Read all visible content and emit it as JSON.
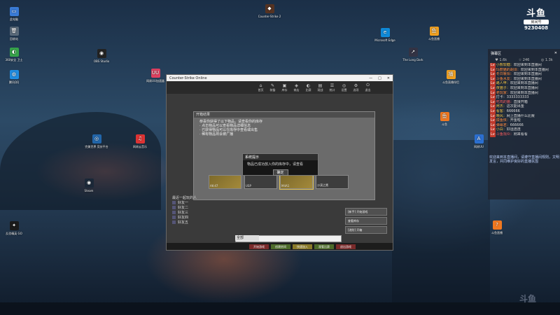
{
  "desktop": {
    "icons_left": [
      {
        "label": "此电脑",
        "color": "#3a7bd5",
        "glyph": "▭"
      },
      {
        "label": "回收站",
        "color": "#5a6a7a",
        "glyph": "🗑"
      },
      {
        "label": "360安全\n卫士",
        "color": "#36a34a",
        "glyph": "◐"
      },
      {
        "label": "腾讯QQ",
        "color": "#1f8ce0",
        "glyph": "◍"
      },
      {
        "label": "完美世界\n竞技平台",
        "color": "#2266aa",
        "glyph": "◎"
      },
      {
        "label": "Steam",
        "color": "#1b2838",
        "glyph": "◉"
      },
      {
        "label": "反恐精英\nGO",
        "color": "#1a1a1a",
        "glyph": "✦"
      }
    ],
    "icons_mid": [
      {
        "label": "OBS Studio",
        "color": "#222",
        "glyph": "◉"
      },
      {
        "label": "网易UU加速器",
        "color": "#e04060",
        "glyph": "UU"
      },
      {
        "label": "网易云音乐",
        "color": "#d33",
        "glyph": "♫"
      },
      {
        "label": "Counter-Strike 2",
        "color": "#553322",
        "glyph": "◆"
      }
    ],
    "icons_right": [
      {
        "label": "Microsoft Edge",
        "color": "#0f8ad8",
        "glyph": "e"
      },
      {
        "label": "斗鱼直播",
        "color": "#f0a020",
        "glyph": "鱼"
      },
      {
        "label": "The Long Dark",
        "color": "#334",
        "glyph": "↗"
      },
      {
        "label": "斗鱼直播伴侣",
        "color": "#f0a020",
        "glyph": "播"
      },
      {
        "label": "斗鱼",
        "color": "#f07820",
        "glyph": "鱼"
      },
      {
        "label": "网易UU",
        "color": "#2b6fd0",
        "glyph": "A"
      },
      {
        "label": "斗鱼直播",
        "color": "#f07820",
        "glyph": "?"
      }
    ]
  },
  "logo": {
    "brand": "斗鱼",
    "room_label": "房间号",
    "room_number": "9230408"
  },
  "chat": {
    "title": "弹幕区",
    "stats": [
      "♥ 1.6k",
      "☆ 246",
      "◎ 1.3k"
    ],
    "messages": [
      {
        "user": "小熊软糖",
        "text": "欢迎来到本直播间",
        "cls": "u-y"
      },
      {
        "user": "玛丽猫的胡须",
        "text": "欢迎来到本直播间",
        "cls": "u-o"
      },
      {
        "user": "冬日暖阳",
        "text": "欢迎来到本直播间",
        "cls": "u-o"
      },
      {
        "user": "斗鱼水友",
        "text": "欢迎来到本直播间",
        "cls": "u-o"
      },
      {
        "user": "路人甲",
        "text": "欢迎来到本直播间",
        "cls": "u-y"
      },
      {
        "user": "夜猫子",
        "text": "欢迎来到本直播间",
        "cls": "u-y"
      },
      {
        "user": "老玩家",
        "text": "欢迎来到本直播间",
        "cls": "u-o"
      },
      {
        "user": "打卡",
        "text": "3333333333",
        "cls": "u-w"
      },
      {
        "user": "吃鸡的猫",
        "text": "直接开箱",
        "cls": "u-r"
      },
      {
        "user": "阿杰",
        "text": "这次能出金",
        "cls": "u-y"
      },
      {
        "user": "看客",
        "text": "666666",
        "cls": "u-y"
      },
      {
        "user": "晚风",
        "text": "网上直播什么比赛",
        "cls": "u-y"
      },
      {
        "user": "摸鱼侠",
        "text": "开金啦",
        "cls": "u-o"
      },
      {
        "user": "弹幕君",
        "text": "666666",
        "cls": "u-o"
      },
      {
        "user": "小白",
        "text": "好运连连",
        "cls": "u-y"
      },
      {
        "user": "斗鱼观众",
        "text": "刚来看看",
        "cls": "u-r"
      }
    ],
    "notice": "欢迎来到本直播间，请遵守直播间规则，文明发言，共同维护良好的直播氛围"
  },
  "game": {
    "window_title": "Counter-Strike Online",
    "window_controls": [
      "—",
      "□",
      "✕"
    ],
    "tabs": [
      {
        "g": "⌂",
        "l": "首页"
      },
      {
        "g": "✎",
        "l": "装备"
      },
      {
        "g": "▣",
        "l": "库存"
      },
      {
        "g": "◈",
        "l": "商店"
      },
      {
        "g": "◐",
        "l": "比赛"
      },
      {
        "g": "▤",
        "l": "观战"
      },
      {
        "g": "☰",
        "l": "统计"
      },
      {
        "g": "◎",
        "l": "设置"
      },
      {
        "g": "⚙",
        "l": "选项"
      },
      {
        "g": "⏻",
        "l": "退出"
      }
    ],
    "panel_title": "开箱结果",
    "panel_lines": [
      "恭喜你获得了以下物品，请查看你的库存",
      "· 点击物品可以查看物品详细信息",
      "· 已获得物品可以在库存中查看或出售",
      "· 稀有物品将会被广播"
    ],
    "cases": [
      {
        "label": "AK-47",
        "gold": true,
        "sel": false
      },
      {
        "label": "USP",
        "gold": false,
        "sel": false
      },
      {
        "label": "M4A1",
        "gold": true,
        "sel": true
      },
      {
        "label": "沙漠之鹰",
        "gold": false,
        "sel": false
      }
    ],
    "dialog": {
      "title": "系统提示",
      "body": "物品已成功放入你的库存中，请查看",
      "ok": "确定"
    },
    "friends_header": "最近一起玩的人",
    "friends": [
      "好友一",
      "好友二",
      "好友三",
      "好友四",
      "好友五"
    ],
    "right_buttons": [
      "[新手] 开始游戏",
      "查看库存",
      "[进阶] 开箱"
    ],
    "chat_channel": "全部",
    "bottom_buttons": [
      {
        "l": "开始游戏",
        "c": "#7a2a2a"
      },
      {
        "l": "创建房间",
        "c": "#4d6b2a"
      },
      {
        "l": "快速加入",
        "c": "#8a7a2a"
      },
      {
        "l": "观看比赛",
        "c": "#4d6b2a"
      },
      {
        "l": "退出游戏",
        "c": "#7a2a2a"
      }
    ]
  },
  "watermark": "斗鱼"
}
